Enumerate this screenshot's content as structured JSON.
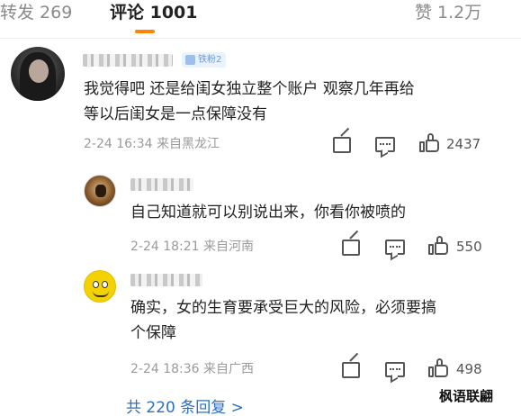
{
  "tabs": {
    "repost": "转发 269",
    "comment": "评论 1001",
    "like": "赞 1.2万"
  },
  "colors": {
    "accent": "#ff8200",
    "link": "#2b6fc2",
    "meta": "#9a9a9a"
  },
  "main_comment": {
    "fan_badge": "铁粉2",
    "text_line1": "我觉得吧  还是给闺女独立整个账户  观察几年再给",
    "text_line2": "等以后闺女是一点保障没有",
    "meta": "2-24 16:34 来自黑龙江",
    "likes": "2437"
  },
  "replies": [
    {
      "text_line1": "自己知道就可以别说出来，你看你被喷的",
      "text_line2": "",
      "meta": "2-24 18:21 来自河南",
      "likes": "550"
    },
    {
      "text_line1": "确实，女的生育要承受巨大的风险，必须要搞",
      "text_line2": "个保障",
      "meta": "2-24 18:36 来自广西",
      "likes": "498"
    }
  ],
  "more_replies": "共 220 条回复 >",
  "watermark": "枫语联翩",
  "icons": [
    "share-icon",
    "comment-icon",
    "like-icon"
  ]
}
